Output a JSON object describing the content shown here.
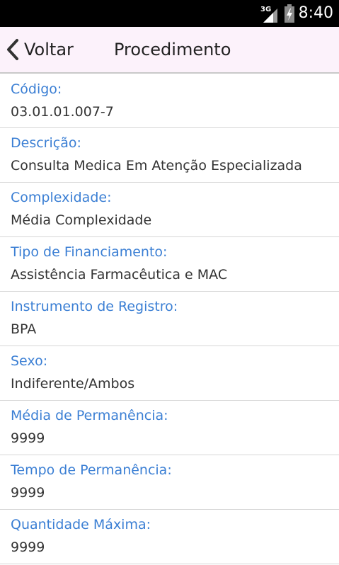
{
  "status_bar": {
    "network": "3G",
    "time": "8:40"
  },
  "header": {
    "back_label": "Voltar",
    "title": "Procedimento"
  },
  "fields": [
    {
      "label": "Código:",
      "value": "03.01.01.007-7"
    },
    {
      "label": "Descrição:",
      "value": "Consulta Medica Em Atenção Especializada"
    },
    {
      "label": "Complexidade:",
      "value": "Média Complexidade"
    },
    {
      "label": "Tipo de Financiamento:",
      "value": "Assistência Farmacêutica e MAC"
    },
    {
      "label": "Instrumento de Registro:",
      "value": "BPA"
    },
    {
      "label": "Sexo:",
      "value": "Indiferente/Ambos"
    },
    {
      "label": "Média de Permanência:",
      "value": "9999"
    },
    {
      "label": "Tempo de Permanência:",
      "value": "9999"
    },
    {
      "label": "Quantidade Máxima:",
      "value": "9999"
    }
  ],
  "colors": {
    "label": "#3b7fd4",
    "value": "#333333",
    "header_bg": "#fcf2fb",
    "status_bg": "#000000"
  }
}
